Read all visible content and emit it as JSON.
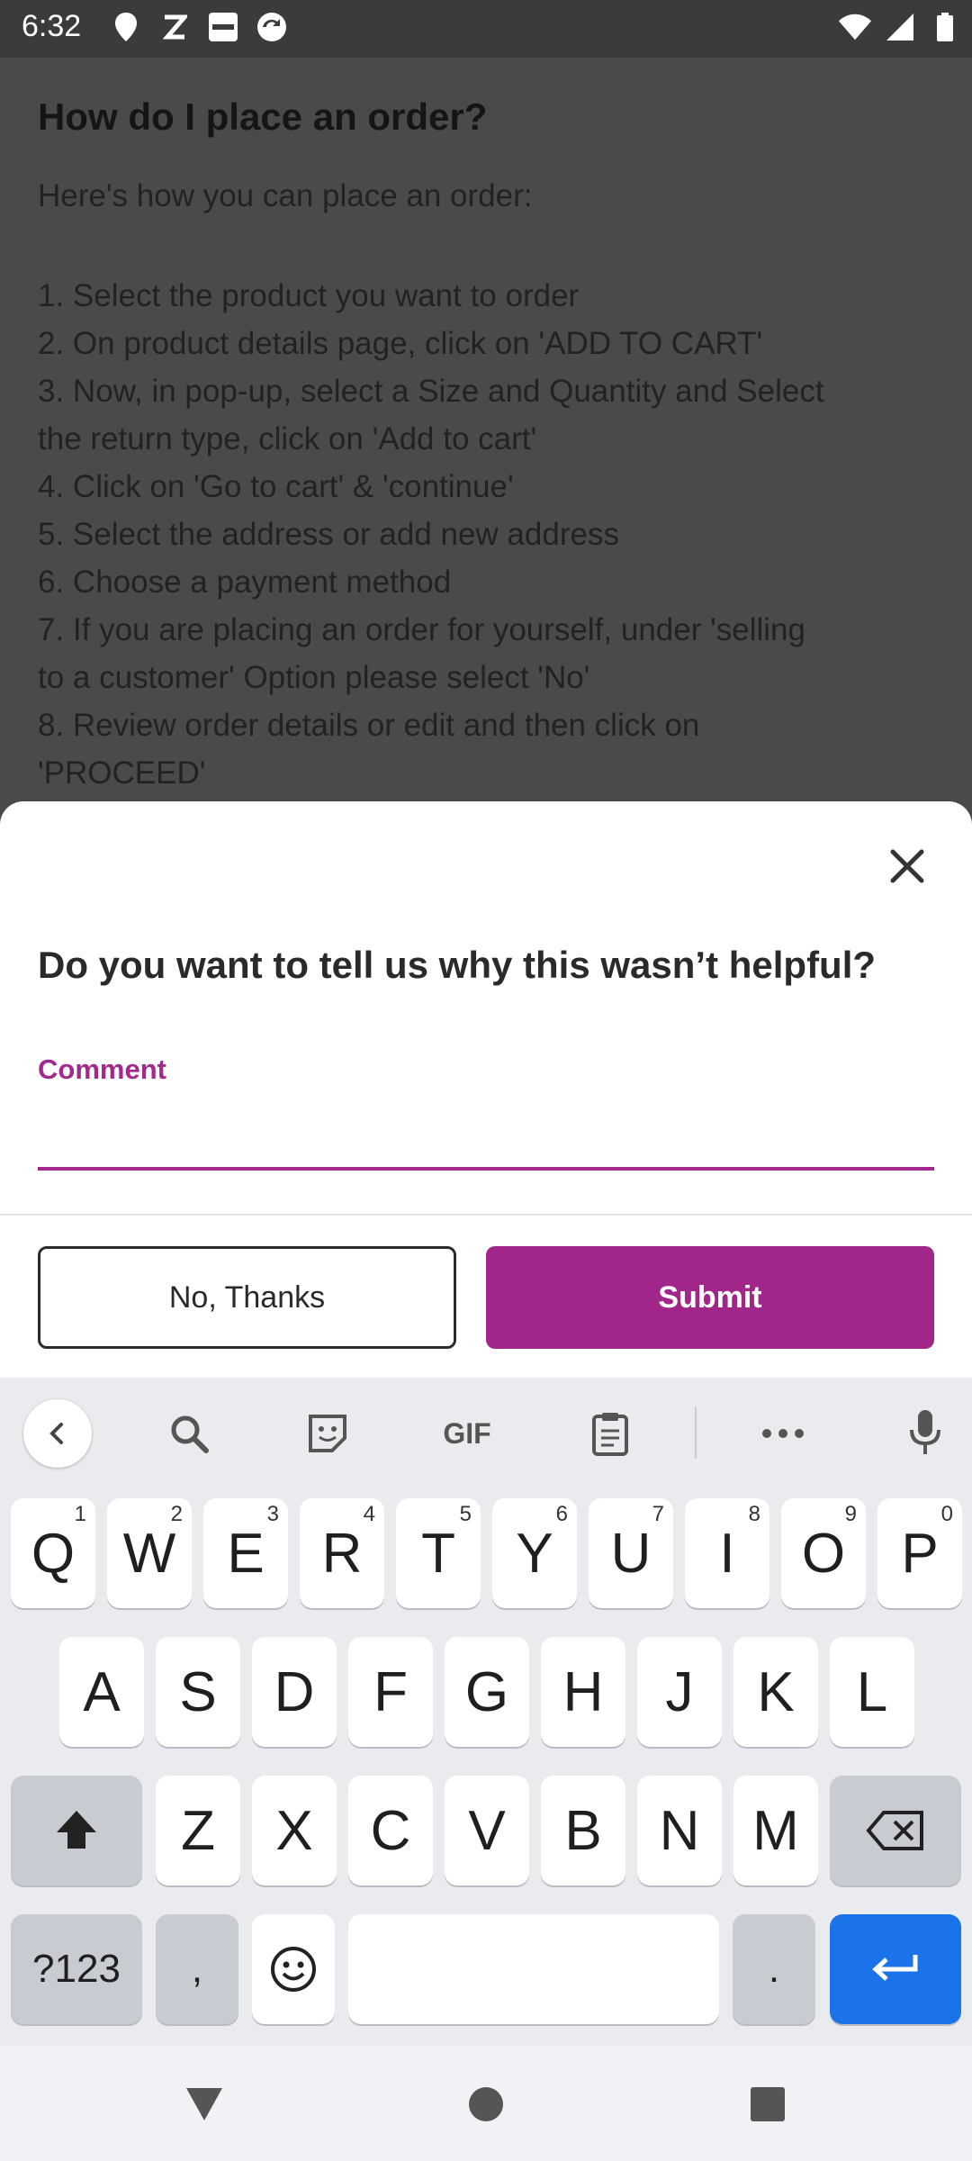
{
  "status_bar": {
    "time": "6:32",
    "left_icons": [
      "location-pin-icon",
      "z-app-icon",
      "blinkit-icon",
      "sync-app-icon"
    ],
    "right_icons": [
      "wifi-icon",
      "cellular-signal-icon",
      "battery-icon"
    ]
  },
  "article": {
    "title": "How do I place an order?",
    "intro": "Here's how you can place an order:",
    "steps": [
      "1. Select the product you want to order",
      "2. On product details page, click on 'ADD TO CART'",
      "3. Now, in pop-up, select a Size and Quantity and Select",
      "the return type, click on 'Add to cart'",
      "4. Click on 'Go to cart' & 'continue'",
      "5. Select the address or add new address",
      "6. Choose a payment method",
      "7. If you are placing an order for yourself, under 'selling",
      "to a customer' Option please select 'No'",
      "8. Review order details or edit and then click on",
      "'PROCEED'"
    ]
  },
  "sheet": {
    "title": "Do you want to tell us why this wasn’t helpful?",
    "comment_label": "Comment",
    "comment_value": "",
    "no_thanks_label": "No, Thanks",
    "submit_label": "Submit",
    "accent_color": "#a1268a"
  },
  "keyboard": {
    "toolbar_icons": [
      "back-chevron-icon",
      "search-icon",
      "sticker-icon",
      "gif-icon",
      "clipboard-icon",
      "more-icon",
      "microphone-icon"
    ],
    "gif_label": "GIF",
    "row1": [
      {
        "key": "Q",
        "hint": "1"
      },
      {
        "key": "W",
        "hint": "2"
      },
      {
        "key": "E",
        "hint": "3"
      },
      {
        "key": "R",
        "hint": "4"
      },
      {
        "key": "T",
        "hint": "5"
      },
      {
        "key": "Y",
        "hint": "6"
      },
      {
        "key": "U",
        "hint": "7"
      },
      {
        "key": "I",
        "hint": "8"
      },
      {
        "key": "O",
        "hint": "9"
      },
      {
        "key": "P",
        "hint": "0"
      }
    ],
    "row2": [
      "A",
      "S",
      "D",
      "F",
      "G",
      "H",
      "J",
      "K",
      "L"
    ],
    "row3": [
      "Z",
      "X",
      "C",
      "V",
      "B",
      "N",
      "M"
    ],
    "symbols_label": "?123",
    "comma_label": ",",
    "period_label": "."
  },
  "nav_bar": {
    "icons": [
      "back-triangle-icon",
      "home-circle-icon",
      "recents-square-icon"
    ]
  }
}
